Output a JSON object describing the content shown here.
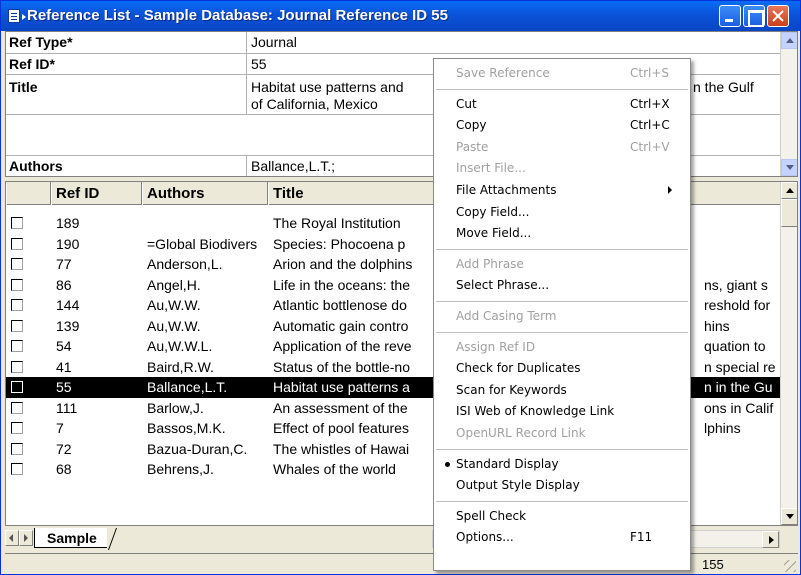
{
  "window": {
    "title": "Reference List - Sample Database: Journal Reference ID 55"
  },
  "fields": [
    {
      "label": "Ref Type*",
      "value": "Journal"
    },
    {
      "label": "Ref ID*",
      "value": "55"
    },
    {
      "label": "Title",
      "value": "Habitat use patterns and",
      "value2": "of California, Mexico",
      "value_overflow": "n the Gulf"
    },
    {
      "label": "Authors",
      "value": "Ballance,L.T.;"
    }
  ],
  "list": {
    "columns": [
      "Ref ID",
      "Authors",
      "Title"
    ],
    "rows": [
      {
        "id": "189",
        "authors": "",
        "title": "The Royal Institution",
        "tail": ""
      },
      {
        "id": "190",
        "authors": "=Global Biodivers",
        "title": "Species: Phocoena p",
        "tail": ""
      },
      {
        "id": "77",
        "authors": "Anderson,L.",
        "title": "Arion and the dolphins",
        "tail": ""
      },
      {
        "id": "86",
        "authors": "Angel,H.",
        "title": "Life in the oceans: the",
        "tail": "ns, giant s"
      },
      {
        "id": "144",
        "authors": "Au,W.W.",
        "title": "Atlantic bottlenose do",
        "tail": "reshold for"
      },
      {
        "id": "139",
        "authors": "Au,W.W.",
        "title": "Automatic gain contro",
        "tail": "hins"
      },
      {
        "id": "54",
        "authors": "Au,W.W.L.",
        "title": "Application of the reve",
        "tail": "quation to"
      },
      {
        "id": "41",
        "authors": "Baird,R.W.",
        "title": "Status of the bottle-no",
        "tail": "n special re"
      },
      {
        "id": "55",
        "authors": "Ballance,L.T.",
        "title": "Habitat use patterns a",
        "tail": "n in the Gu",
        "selected": true
      },
      {
        "id": "111",
        "authors": "Barlow,J.",
        "title": "An assessment of the",
        "tail": "ons in Calif"
      },
      {
        "id": "7",
        "authors": "Bassos,M.K.",
        "title": "Effect of pool features",
        "tail": "lphins"
      },
      {
        "id": "72",
        "authors": "Bazua-Duran,C.",
        "title": "The whistles of Hawai",
        "tail": ""
      },
      {
        "id": "68",
        "authors": "Behrens,J.",
        "title": "Whales of the world",
        "tail": ""
      }
    ]
  },
  "sheet_tab": "Sample",
  "status": {
    "count": "155"
  },
  "context_menu": [
    {
      "label": "Save Reference",
      "shortcut": "Ctrl+S",
      "disabled": true
    },
    {
      "sep": true
    },
    {
      "label": "Cut",
      "shortcut": "Ctrl+X"
    },
    {
      "label": "Copy",
      "shortcut": "Ctrl+C"
    },
    {
      "label": "Paste",
      "shortcut": "Ctrl+V",
      "disabled": true
    },
    {
      "label": "Insert File...",
      "disabled": true
    },
    {
      "label": "File Attachments",
      "submenu": true
    },
    {
      "label": "Copy Field..."
    },
    {
      "label": "Move Field..."
    },
    {
      "sep": true
    },
    {
      "label": "Add Phrase",
      "disabled": true
    },
    {
      "label": "Select Phrase..."
    },
    {
      "sep": true
    },
    {
      "label": "Add Casing Term",
      "disabled": true
    },
    {
      "sep": true
    },
    {
      "label": "Assign Ref ID",
      "disabled": true
    },
    {
      "label": "Check for Duplicates"
    },
    {
      "label": "Scan for Keywords"
    },
    {
      "label": "ISI Web of Knowledge Link"
    },
    {
      "label": "OpenURL Record Link",
      "disabled": true
    },
    {
      "sep": true
    },
    {
      "label": "Standard Display",
      "checked": true
    },
    {
      "label": "Output Style Display"
    },
    {
      "sep": true
    },
    {
      "label": "Spell Check"
    },
    {
      "label": "Options...",
      "shortcut": "F11"
    }
  ]
}
